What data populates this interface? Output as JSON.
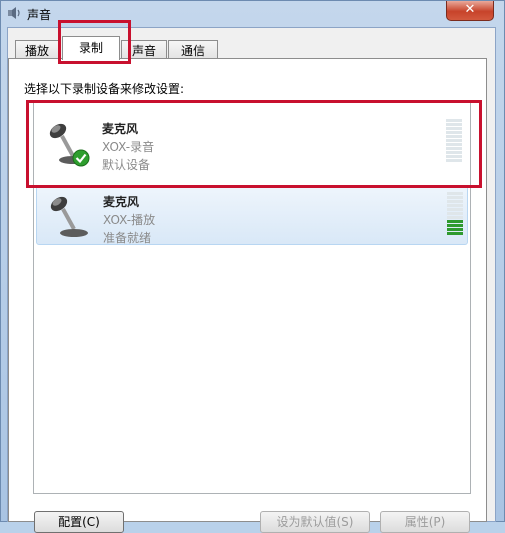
{
  "window": {
    "title": "声音",
    "close_label": "✕"
  },
  "tabs": [
    {
      "label": "播放"
    },
    {
      "label": "录制"
    },
    {
      "label": "声音"
    },
    {
      "label": "通信"
    }
  ],
  "instruction": "选择以下录制设备来修改设置:",
  "devices": [
    {
      "name": "麦克风",
      "description": "XOX-录音",
      "status": "默认设备",
      "default": true,
      "level": 0
    },
    {
      "name": "麦克风",
      "description": "XOX-播放",
      "status": "准备就绪",
      "default": false,
      "level": 0.3
    }
  ],
  "buttons": {
    "configure": "配置(C)",
    "set_default": "设为默认值(S)",
    "properties": "属性(P)"
  },
  "colors": {
    "highlight_box": "#c8102e",
    "meter_active": "#2f9a2f"
  }
}
